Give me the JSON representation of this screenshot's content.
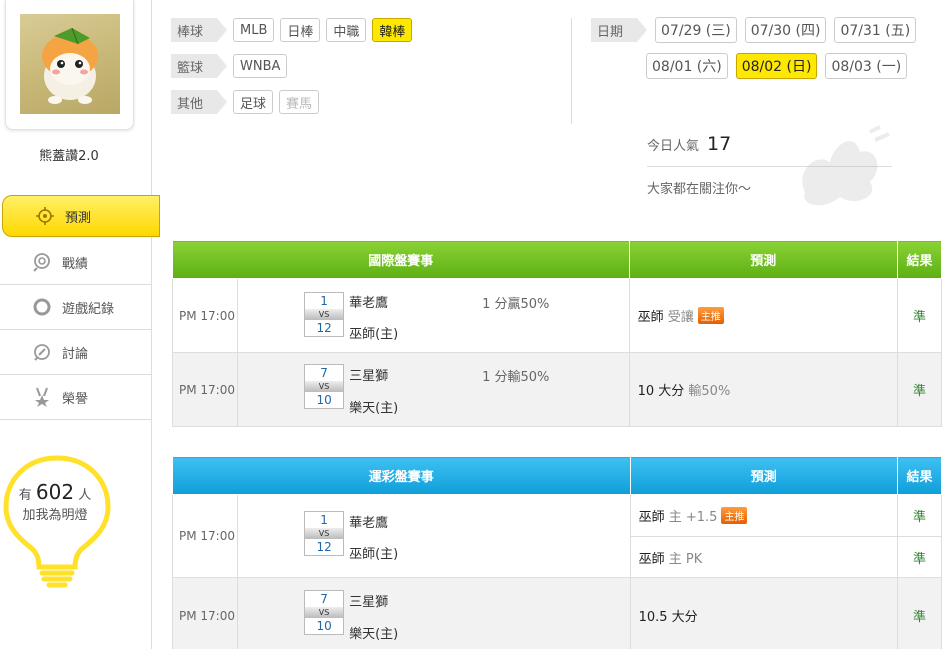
{
  "user": {
    "name": "熊蓋讚2.0"
  },
  "nav": [
    {
      "label": "預測",
      "icon": "target-icon",
      "active": true
    },
    {
      "label": "戰績",
      "icon": "record-icon"
    },
    {
      "label": "遊戲紀錄",
      "icon": "ring-icon"
    },
    {
      "label": "討論",
      "icon": "chat-icon"
    },
    {
      "label": "榮譽",
      "icon": "medal-icon"
    }
  ],
  "lamp": {
    "prefix": "有",
    "count": "602",
    "suffix": "人",
    "line2": "加我為明燈"
  },
  "filters": {
    "baseball": {
      "label": "棒球",
      "items": [
        "MLB",
        "日棒",
        "中職",
        "韓棒"
      ],
      "selected": "韓棒"
    },
    "basketball": {
      "label": "籃球",
      "items": [
        "WNBA"
      ]
    },
    "other": {
      "label": "其他",
      "items": [
        "足球",
        "賽馬"
      ]
    },
    "date": {
      "label": "日期",
      "items": [
        "07/29 (三)",
        "07/30 (四)",
        "07/31 (五)",
        "08/01 (六)",
        "08/02 (日)",
        "08/03 (一)"
      ],
      "selected": "08/02 (日)"
    }
  },
  "popularity": {
    "label": "今日人氣",
    "count": "17",
    "subtitle": "大家都在關注你～"
  },
  "intl": {
    "header": "國際盤賽事",
    "pred_header": "預測",
    "result_header": "結果",
    "rows": [
      {
        "time": "PM 17:00",
        "away_score": "1",
        "home_score": "12",
        "vs": "VS",
        "away": "華老鷹",
        "home": "巫師(主)",
        "odds": "1 分贏50%",
        "pick": "巫師",
        "pick_note": "受讓",
        "badge": "主推",
        "result": "準"
      },
      {
        "time": "PM 17:00",
        "away_score": "7",
        "home_score": "10",
        "vs": "VS",
        "away": "三星獅",
        "home": "樂天(主)",
        "odds": "1 分輸50%",
        "pick": "10 大分",
        "pick_note": "輸50%",
        "result": "準"
      }
    ]
  },
  "sport": {
    "header": "運彩盤賽事",
    "pred_header": "預測",
    "result_header": "結果",
    "rows": [
      {
        "time": "PM 17:00",
        "away_score": "1",
        "home_score": "12",
        "vs": "VS",
        "away": "華老鷹",
        "home": "巫師(主)",
        "picks": [
          {
            "pick": "巫師",
            "pick_note": "主 +1.5",
            "badge": "主推",
            "result": "準"
          },
          {
            "pick": "巫師",
            "pick_note": "主 PK",
            "result": "準"
          }
        ]
      },
      {
        "time": "PM 17:00",
        "away_score": "7",
        "home_score": "10",
        "vs": "VS",
        "away": "三星獅",
        "home": "樂天(主)",
        "picks": [
          {
            "pick": "10.5 大分",
            "pick_note": "",
            "result": "準"
          }
        ]
      }
    ]
  }
}
